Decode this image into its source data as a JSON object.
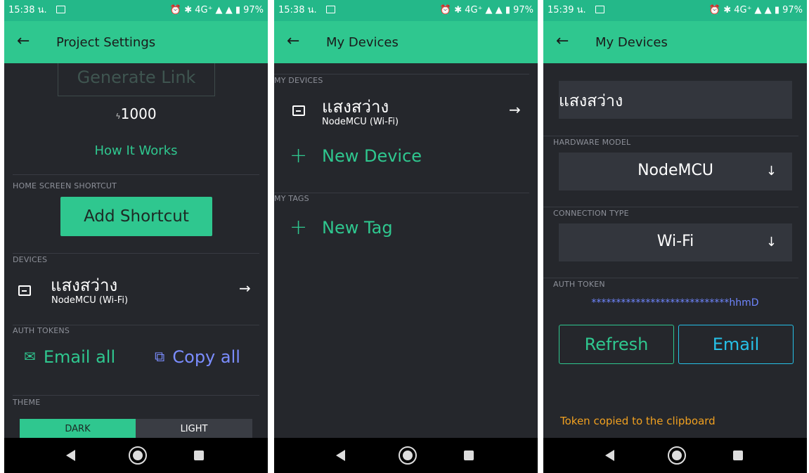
{
  "status_bar": [
    {
      "time": "15:38 น.",
      "icons": "⏰ ✱ 4G⁺ ▲ ▲ ▮ 97%"
    },
    {
      "time": "15:38 น.",
      "icons": "⏰ ✱ 4G⁺ ▲ ▲ ▮ 97%"
    },
    {
      "time": "15:39 น.",
      "icons": "⏰ ✱ 4G⁺ ▲ ▲ ▮ 97%"
    }
  ],
  "screen1": {
    "title": "Project Settings",
    "generate_link": "Generate Link",
    "energy": "1000",
    "how_it_works": "How It Works",
    "home_shortcut_label": "HOME SCREEN SHORTCUT",
    "add_shortcut": "Add Shortcut",
    "devices_label": "DEVICES",
    "device_name": "แสงสว่าง",
    "device_sub": "NodeMCU (Wi-Fi)",
    "auth_tokens_label": "AUTH TOKENS",
    "email_all": "Email all",
    "copy_all": "Copy all",
    "theme_label": "THEME",
    "theme_dark": "DARK",
    "theme_light": "LIGHT"
  },
  "screen2": {
    "title": "My Devices",
    "my_devices_label": "MY DEVICES",
    "device_name": "แสงสว่าง",
    "device_sub": "NodeMCU (Wi-Fi)",
    "new_device": "New Device",
    "my_tags_label": "MY TAGS",
    "new_tag": "New Tag"
  },
  "screen3": {
    "title": "My Devices",
    "device_name_value": "แสงสว่าง",
    "hardware_label": "HARDWARE MODEL",
    "hardware_value": "NodeMCU",
    "connection_label": "CONNECTION TYPE",
    "connection_value": "Wi-Fi",
    "auth_label": "AUTH TOKEN",
    "auth_token": "****************************hhmD",
    "refresh": "Refresh",
    "email": "Email",
    "toast": "Token copied to the clipboard"
  },
  "colors": {
    "accent": "#2fc78f",
    "status_bar": "#24b889",
    "background": "#25272c",
    "field": "#33363d",
    "token": "#6f86ff",
    "email_blue": "#26c1e8",
    "toast": "#f0a020"
  }
}
